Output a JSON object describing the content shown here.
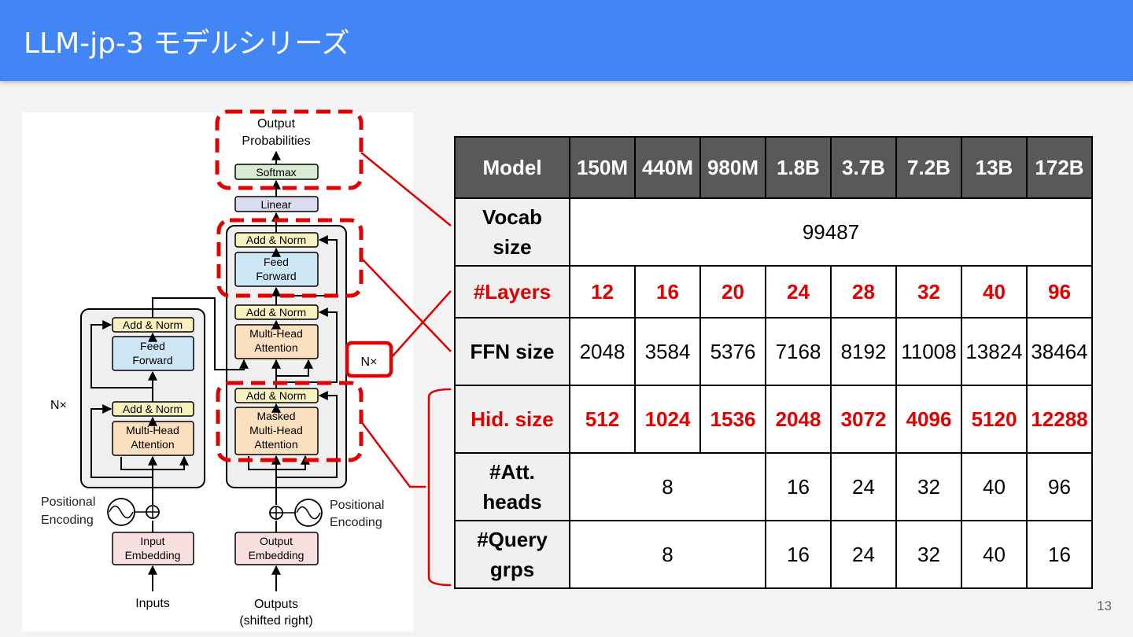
{
  "slide": {
    "title": "LLM-jp-3 モデルシリーズ",
    "page_number": "13"
  },
  "diagram": {
    "output_probabilities_line1": "Output",
    "output_probabilities_line2": "Probabilities",
    "softmax": "Softmax",
    "linear": "Linear",
    "add_norm": "Add & Norm",
    "feed_forward_line1": "Feed",
    "feed_forward_line2": "Forward",
    "multi_head_line1": "Multi-Head",
    "multi_head_line2": "Attention",
    "masked_line1": "Masked",
    "positional_line1": "Positional",
    "positional_line2": "Encoding",
    "input_embedding_line1": "Input",
    "embedding": "Embedding",
    "output_embedding_line1": "Output",
    "inputs": "Inputs",
    "outputs_line1": "Outputs",
    "outputs_line2": "(shifted right)",
    "nx_left": "N×",
    "nx_right": "N×"
  },
  "table": {
    "header": [
      "Model",
      "150M",
      "440M",
      "980M",
      "1.8B",
      "3.7B",
      "7.2B",
      "13B",
      "172B"
    ],
    "vocab": {
      "label_line1": "Vocab",
      "label_line2": "size",
      "value": "99487"
    },
    "layers": {
      "label": "#Layers",
      "values": [
        "12",
        "16",
        "20",
        "24",
        "28",
        "32",
        "40",
        "96"
      ]
    },
    "ffn": {
      "label": "FFN size",
      "values": [
        "2048",
        "3584",
        "5376",
        "7168",
        "8192",
        "11008",
        "13824",
        "38464"
      ]
    },
    "hid": {
      "label": "Hid. size",
      "values": [
        "512",
        "1024",
        "1536",
        "2048",
        "3072",
        "4096",
        "5120",
        "12288"
      ]
    },
    "att_heads": {
      "label_line1": "#Att.",
      "label_line2": "heads",
      "values": [
        "8",
        "16",
        "24",
        "32",
        "40",
        "96"
      ]
    },
    "query_grps": {
      "label_line1": "#Query",
      "label_line2": "grps",
      "values": [
        "8",
        "16",
        "24",
        "32",
        "40",
        "16"
      ]
    }
  },
  "colors": {
    "header_bg": "#4285f4",
    "highlight_red": "#e00000",
    "table_header_bg": "#595959"
  }
}
